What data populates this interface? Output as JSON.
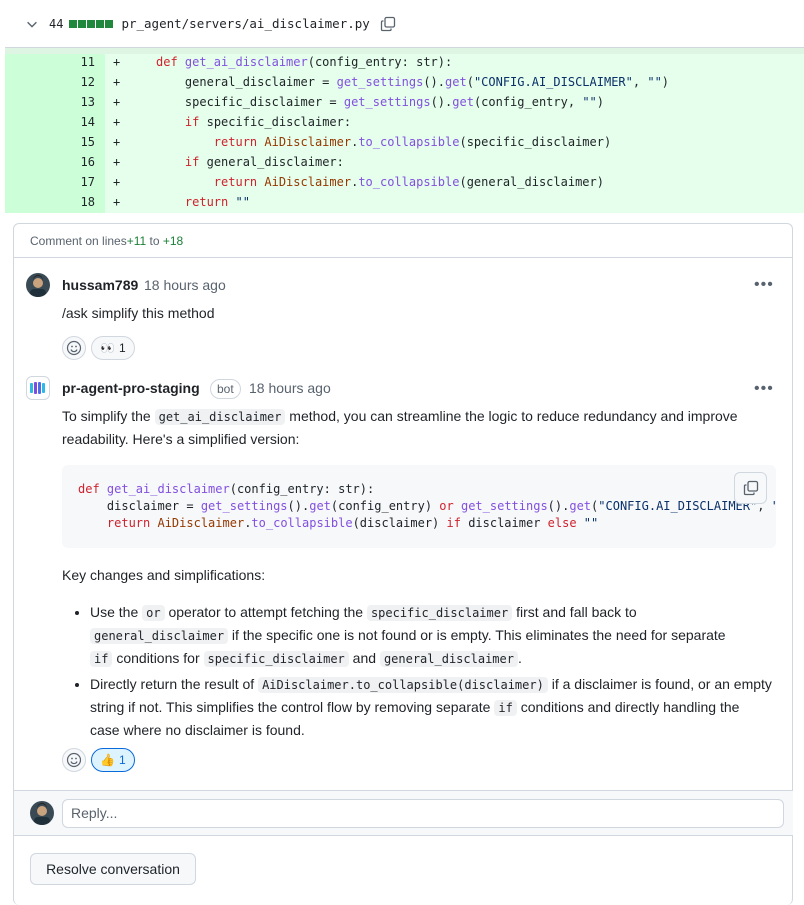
{
  "file": {
    "changes_count": "44",
    "path": "pr_agent/servers/ai_disclaimer.py"
  },
  "diff": {
    "lines": [
      {
        "num": "11",
        "sign": "+",
        "indent": "",
        "tokens": [
          [
            "kw",
            "def "
          ],
          [
            "fn",
            "get_ai_disclaimer"
          ],
          [
            "",
            "(config_entry: str):"
          ]
        ]
      },
      {
        "num": "12",
        "sign": "+",
        "indent": "    ",
        "tokens": [
          [
            "",
            "general_disclaimer = "
          ],
          [
            "fn",
            "get_settings"
          ],
          [
            "",
            "()."
          ],
          [
            "fn",
            "get"
          ],
          [
            "",
            "("
          ],
          [
            "str",
            "\"CONFIG.AI_DISCLAIMER\""
          ],
          [
            "",
            ", "
          ],
          [
            "str",
            "\"\""
          ],
          [
            "",
            ")"
          ]
        ]
      },
      {
        "num": "13",
        "sign": "+",
        "indent": "    ",
        "tokens": [
          [
            "",
            "specific_disclaimer = "
          ],
          [
            "fn",
            "get_settings"
          ],
          [
            "",
            "()."
          ],
          [
            "fn",
            "get"
          ],
          [
            "",
            "(config_entry, "
          ],
          [
            "str",
            "\"\""
          ],
          [
            "",
            ")"
          ]
        ]
      },
      {
        "num": "14",
        "sign": "+",
        "indent": "    ",
        "tokens": [
          [
            "kw",
            "if "
          ],
          [
            "",
            "specific_disclaimer:"
          ]
        ]
      },
      {
        "num": "15",
        "sign": "+",
        "indent": "        ",
        "tokens": [
          [
            "kw",
            "return "
          ],
          [
            "cls",
            "AiDisclaimer"
          ],
          [
            "",
            "."
          ],
          [
            "fn",
            "to_collapsible"
          ],
          [
            "",
            "(specific_disclaimer)"
          ]
        ]
      },
      {
        "num": "16",
        "sign": "+",
        "indent": "    ",
        "tokens": [
          [
            "kw",
            "if "
          ],
          [
            "",
            "general_disclaimer:"
          ]
        ]
      },
      {
        "num": "17",
        "sign": "+",
        "indent": "        ",
        "tokens": [
          [
            "kw",
            "return "
          ],
          [
            "cls",
            "AiDisclaimer"
          ],
          [
            "",
            "."
          ],
          [
            "fn",
            "to_collapsible"
          ],
          [
            "",
            "(general_disclaimer)"
          ]
        ]
      },
      {
        "num": "18",
        "sign": "+",
        "indent": "    ",
        "tokens": [
          [
            "kw",
            "return "
          ],
          [
            "str",
            "\"\""
          ]
        ]
      }
    ]
  },
  "conversation": {
    "header_prefix": "Comment on lines ",
    "line_start": "+11",
    "header_to": " to ",
    "line_end": "+18",
    "comment1": {
      "author": "hussam789",
      "time": "18 hours ago",
      "body": "/ask simplify this method",
      "reaction_emoji": "👀",
      "reaction_count": "1"
    },
    "comment2": {
      "author": "pr-agent-pro-staging",
      "badge": "bot",
      "time": "18 hours ago",
      "intro_1": "To simplify the ",
      "intro_code": "get_ai_disclaimer",
      "intro_2": " method, you can streamline the logic to reduce redundancy and improve",
      "intro_3": "readability. Here's a simplified version:",
      "code_lines": [
        [
          [
            "kw",
            "def "
          ],
          [
            "fn",
            "get_ai_disclaimer"
          ],
          [
            "",
            "(config_entry: str):"
          ]
        ],
        [
          [
            "",
            "    disclaimer = "
          ],
          [
            "fn",
            "get_settings"
          ],
          [
            "",
            "()."
          ],
          [
            "fn",
            "get"
          ],
          [
            "",
            "(config_entry) "
          ],
          [
            "kw",
            "or "
          ],
          [
            "fn",
            "get_settings"
          ],
          [
            "",
            "()."
          ],
          [
            "fn",
            "get"
          ],
          [
            "",
            "("
          ],
          [
            "str",
            "\"CONFIG.AI_DISCLAIMER\""
          ],
          [
            "",
            ", "
          ],
          [
            "str",
            "\"\""
          ],
          [
            "",
            ")"
          ]
        ],
        [
          [
            "kw",
            "    return "
          ],
          [
            "cls",
            "AiDisclaimer"
          ],
          [
            "",
            "."
          ],
          [
            "fn",
            "to_collapsible"
          ],
          [
            "",
            "(disclaimer) "
          ],
          [
            "kw",
            "if "
          ],
          [
            "",
            "disclaimer "
          ],
          [
            "kw",
            "else "
          ],
          [
            "str",
            "\"\""
          ]
        ]
      ],
      "key_changes_heading": "Key changes and simplifications:",
      "bullet1": {
        "a": "Use the ",
        "c1": "or",
        "b": " operator to attempt fetching the ",
        "c2": "specific_disclaimer",
        "c": " first and fall back to",
        "c3": "general_disclaimer",
        "d": " if the specific one is not found or is empty. This eliminates the need for separate",
        "c4": "if",
        "e": " conditions for ",
        "c5": "specific_disclaimer",
        "f": " and ",
        "c6": "general_disclaimer",
        "g": "."
      },
      "bullet2": {
        "a": "Directly return the result of ",
        "c1": "AiDisclaimer.to_collapsible(disclaimer)",
        "b": " if a disclaimer is found, or an empty string if not. This simplifies the control flow by removing separate ",
        "c2": "if",
        "c": " conditions and directly handling the case where no disclaimer is found."
      },
      "reaction_emoji": "👍",
      "reaction_count": "1"
    },
    "reply_placeholder": "Reply...",
    "resolve_label": "Resolve conversation"
  }
}
